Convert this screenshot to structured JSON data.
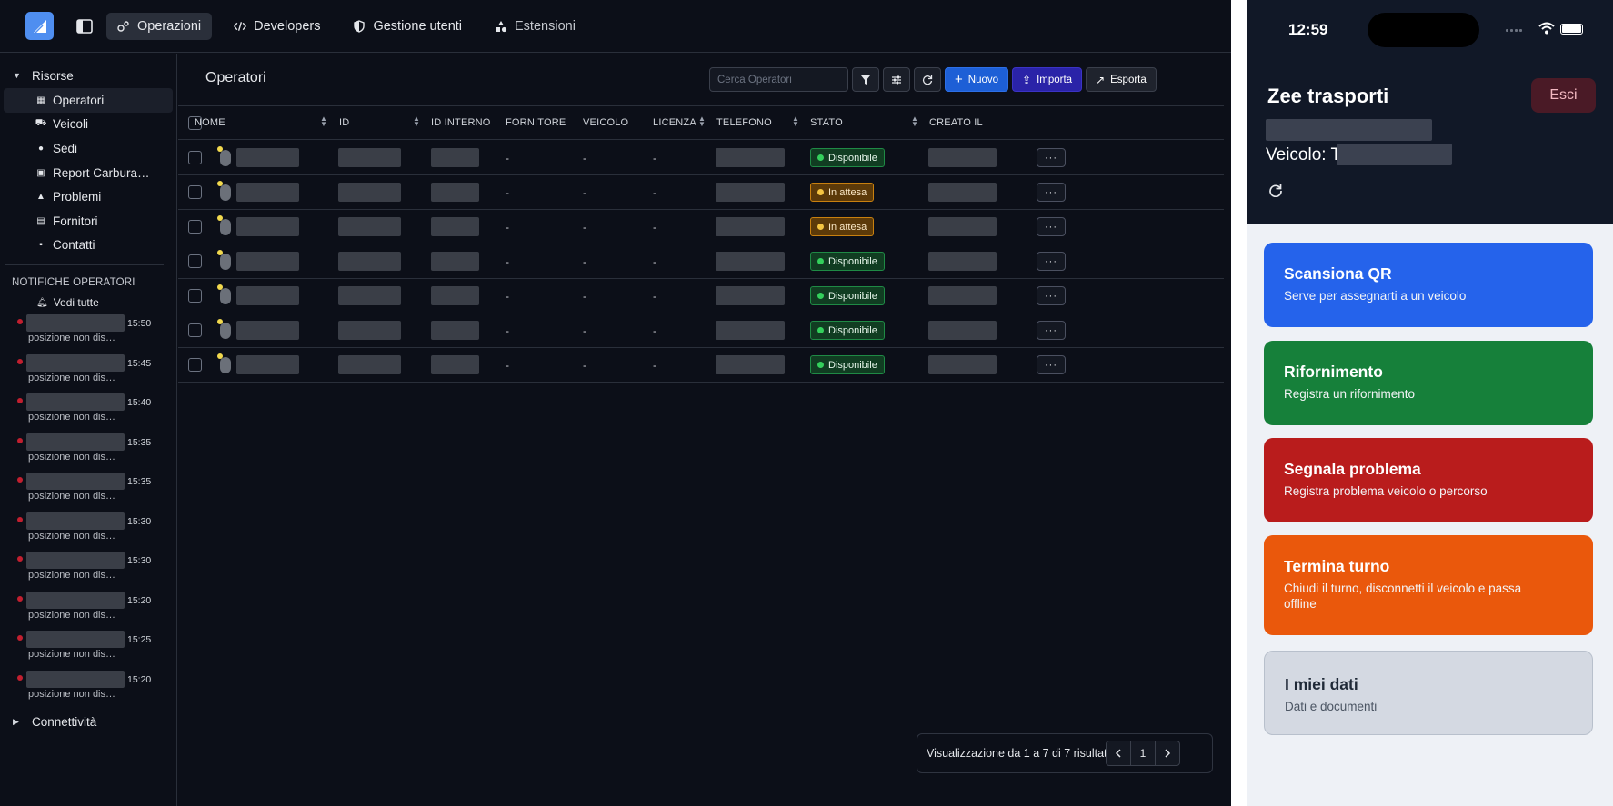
{
  "topbar": {
    "tabs": [
      {
        "label": "Operazioni",
        "icon": "operations-icon"
      },
      {
        "label": "Developers",
        "icon": "code-icon"
      },
      {
        "label": "Gestione utenti",
        "icon": "shield-icon"
      },
      {
        "label": "Estensioni",
        "icon": "extensions-icon"
      }
    ]
  },
  "sidebar": {
    "group_resources": "Risorse",
    "items": [
      {
        "label": "Operatori",
        "icon": "grid-icon"
      },
      {
        "label": "Veicoli",
        "icon": "truck-icon"
      },
      {
        "label": "Sedi",
        "icon": "pin-icon"
      },
      {
        "label": "Report Carbura…",
        "icon": "fuel-icon"
      },
      {
        "label": "Problemi",
        "icon": "warning-icon"
      },
      {
        "label": "Fornitori",
        "icon": "store-icon"
      },
      {
        "label": "Contatti",
        "icon": "contacts-icon"
      }
    ],
    "notifications_title": "NOTIFICHE OPERATORI",
    "see_all": "Vedi tutte",
    "notifications": [
      {
        "time": "15:50",
        "message": "posizione non dis…"
      },
      {
        "time": "15:45",
        "message": "posizione non dis…"
      },
      {
        "time": "15:40",
        "message": "posizione non dis…"
      },
      {
        "time": "15:35",
        "message": "posizione non dis…"
      },
      {
        "time": "15:35",
        "message": "posizione non dis…"
      },
      {
        "time": "15:30",
        "message": "posizione non dis…"
      },
      {
        "time": "15:30",
        "message": "posizione non dis…"
      },
      {
        "time": "15:20",
        "message": "posizione non dis…"
      },
      {
        "time": "15:25",
        "message": "posizione non dis…"
      },
      {
        "time": "15:20",
        "message": "posizione non dis…"
      }
    ],
    "group_connectivity": "Connettività"
  },
  "main": {
    "title": "Operatori",
    "search_placeholder": "Cerca Operatori",
    "new_label": "Nuovo",
    "import_label": "Importa",
    "export_label": "Esporta",
    "columns": {
      "name": "NOME",
      "id": "ID",
      "internal_id": "ID INTERNO",
      "supplier": "FORNITORE",
      "vehicle": "VEICOLO",
      "license": "LICENZA",
      "phone": "TELEFONO",
      "status": "STATO",
      "created": "CREATO IL"
    },
    "rows": [
      {
        "supplier": "-",
        "vehicle": "-",
        "license": "-",
        "status": "Disponibile",
        "status_kind": "ok"
      },
      {
        "supplier": "-",
        "vehicle": "-",
        "license": "-",
        "status": "In attesa",
        "status_kind": "wait"
      },
      {
        "supplier": "-",
        "vehicle": "-",
        "license": "-",
        "status": "In attesa",
        "status_kind": "wait"
      },
      {
        "supplier": "-",
        "vehicle": "-",
        "license": "-",
        "status": "Disponibile",
        "status_kind": "ok"
      },
      {
        "supplier": "-",
        "vehicle": "-",
        "license": "-",
        "status": "Disponibile",
        "status_kind": "ok"
      },
      {
        "supplier": "-",
        "vehicle": "-",
        "license": "-",
        "status": "Disponibile",
        "status_kind": "ok"
      },
      {
        "supplier": "-",
        "vehicle": "-",
        "license": "-",
        "status": "Disponibile",
        "status_kind": "ok"
      }
    ],
    "more_label": "···",
    "pagination_text": "Visualizzazione da 1 a 7 di 7 risultati",
    "current_page": "1"
  },
  "phone": {
    "time": "12:59",
    "company": "Zee trasporti",
    "logout": "Esci",
    "vehicle_label": "Veicolo: T",
    "cards": [
      {
        "title": "Scansiona QR",
        "subtitle": "Serve per assegnarti a un veicolo",
        "color": "#2563eb"
      },
      {
        "title": "Rifornimento",
        "subtitle": "Registra un rifornimento",
        "color": "#16803a"
      },
      {
        "title": "Segnala problema",
        "subtitle": "Registra problema veicolo o percorso",
        "color": "#b91c1c"
      },
      {
        "title": "Termina turno",
        "subtitle": "Chiudi il turno, disconnetti il veicolo e passa offline",
        "color": "#ea580c"
      },
      {
        "title": "I miei dati",
        "subtitle": "Dati e documenti",
        "color": "#d4d9e2"
      }
    ]
  },
  "colors": {
    "ok": "#34d05c",
    "wait": "#f5c542",
    "accent": "#1d5fd6"
  }
}
